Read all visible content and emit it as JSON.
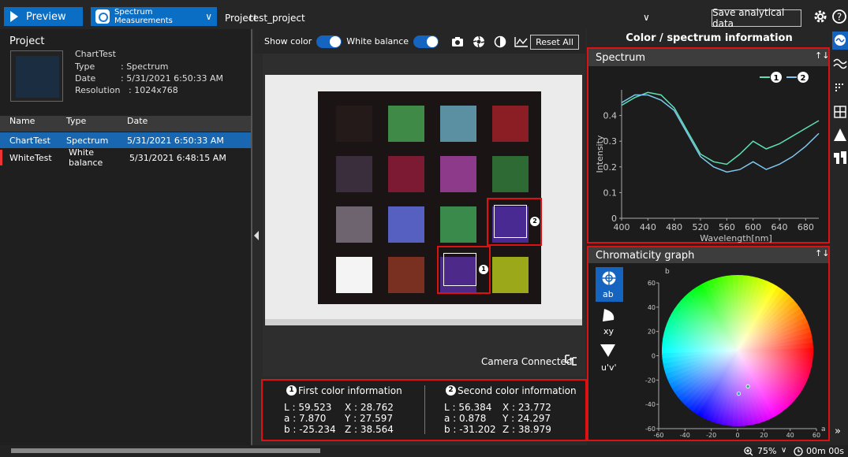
{
  "topbar": {
    "preview_label": "Preview",
    "mode_label_1": "Spectrum",
    "mode_label_2": "Measurements",
    "project_label": "Project",
    "project_name": "test_project",
    "save_label": "Save analytical data"
  },
  "left": {
    "title": "Project",
    "info": {
      "name": "ChartTest",
      "type_key": "Type",
      "type_val": ": Spectrum",
      "date_key": "Date",
      "date_val": ": 5/31/2021 6:50:33 AM",
      "res_key": "Resolution",
      "res_val": ": 1024x768"
    },
    "columns": [
      "Name",
      "Type",
      "Date"
    ],
    "rows": [
      {
        "name": "ChartTest",
        "type": "Spectrum",
        "date": "5/31/2021 6:50:33 AM"
      },
      {
        "name": "WhiteTest",
        "type": "White balance",
        "date": "5/31/2021 6:48:15 AM"
      }
    ]
  },
  "center": {
    "show_color": "Show color",
    "white_balance": "White balance",
    "reset_label": "Reset All",
    "camera_status": "Camera Connected",
    "patches": [
      [
        "#241a1a",
        "#3e8a46",
        "#5b90a2",
        "#8a1e24"
      ],
      [
        "#3b2e3c",
        "#7c1a34",
        "#8e3a8a",
        "#2e6a34"
      ],
      [
        "#6e646f",
        "#5660c0",
        "#3a8a4c",
        "#482a92"
      ],
      [
        "#f4f4f4",
        "#7a3020",
        "#4d2a8a",
        "#9aa81a"
      ]
    ]
  },
  "info": {
    "first_title": "First color information",
    "second_title": "Second color information",
    "first": {
      "L": "L : 59.523",
      "a": "a : 7.870",
      "b": "b : -25.234",
      "X": "X : 28.762",
      "Y": "Y : 27.597",
      "Z": "Z : 38.564"
    },
    "second": {
      "L": "L : 56.384",
      "a": "a : 0.878",
      "b": "b : -31.202",
      "X": "X : 23.772",
      "Y": "Y : 24.297",
      "Z": "Z : 38.979"
    },
    "n1": "1",
    "n2": "2"
  },
  "right": {
    "title": "Color / spectrum information",
    "spectrum_title": "Spectrum",
    "chroma_title": "Chromaticity graph",
    "chroma_buttons": [
      "ab",
      "xy",
      "u'v'"
    ]
  },
  "chart_data": [
    {
      "type": "line",
      "title": "Spectrum",
      "xlabel": "Wavelength[nm]",
      "ylabel": "Intensity",
      "xlim": [
        400,
        700
      ],
      "ylim": [
        0,
        0.5
      ],
      "xticks": [
        400,
        440,
        480,
        520,
        560,
        600,
        640,
        680
      ],
      "yticks": [
        0,
        0.1,
        0.2,
        0.3,
        0.4
      ],
      "series": [
        {
          "name": "1",
          "color": "#5ee0b0",
          "x": [
            400,
            420,
            440,
            460,
            480,
            500,
            520,
            540,
            560,
            580,
            600,
            620,
            640,
            660,
            680,
            700
          ],
          "y": [
            0.44,
            0.47,
            0.49,
            0.48,
            0.43,
            0.34,
            0.25,
            0.22,
            0.21,
            0.25,
            0.3,
            0.27,
            0.29,
            0.32,
            0.35,
            0.38
          ]
        },
        {
          "name": "2",
          "color": "#7ec8f0",
          "x": [
            400,
            420,
            440,
            460,
            480,
            500,
            520,
            540,
            560,
            580,
            600,
            620,
            640,
            660,
            680,
            700
          ],
          "y": [
            0.45,
            0.48,
            0.48,
            0.46,
            0.42,
            0.33,
            0.24,
            0.2,
            0.18,
            0.19,
            0.22,
            0.19,
            0.21,
            0.24,
            0.28,
            0.33
          ]
        }
      ]
    },
    {
      "type": "scatter",
      "title": "Chromaticity graph",
      "xlabel": "a",
      "ylabel": "b",
      "xlim": [
        -60,
        60
      ],
      "ylim": [
        -60,
        60
      ],
      "xticks": [
        -60,
        -40,
        -20,
        0,
        20,
        40,
        60
      ],
      "yticks": [
        -60,
        -40,
        -20,
        0,
        20,
        40,
        60
      ],
      "series": [
        {
          "name": "1",
          "x": [
            7.87
          ],
          "y": [
            -25.234
          ]
        },
        {
          "name": "2",
          "x": [
            0.878
          ],
          "y": [
            -31.202
          ]
        }
      ]
    }
  ],
  "bottom": {
    "zoom": "75%",
    "timer": "00m 00s"
  }
}
